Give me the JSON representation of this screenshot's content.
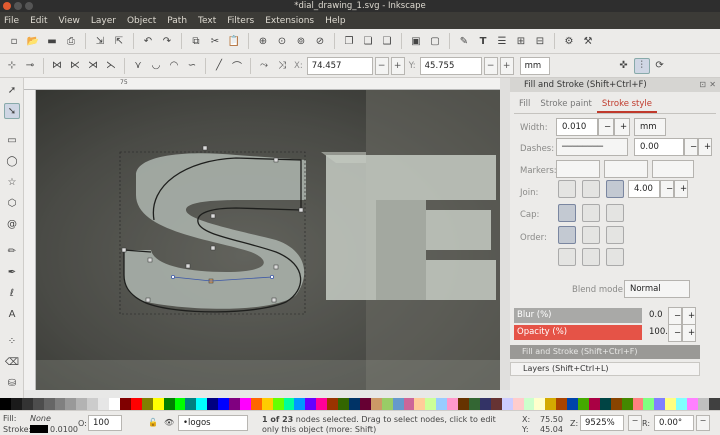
{
  "window": {
    "title": "*dial_drawing_1.svg - Inkscape"
  },
  "menu": [
    "File",
    "Edit",
    "View",
    "Layer",
    "Object",
    "Path",
    "Text",
    "Filters",
    "Extensions",
    "Help"
  ],
  "controls": {
    "x_label": "X:",
    "x_value": "74.457",
    "y_label": "Y:",
    "y_value": "45.755",
    "unit": "mm"
  },
  "ruler": {
    "h_mark": "75"
  },
  "panel": {
    "title": "Fill and Stroke (Shift+Ctrl+F)",
    "tabs": [
      "Fill",
      "Stroke paint",
      "Stroke style"
    ],
    "width_label": "Width:",
    "width_value": "0.010",
    "width_unit": "mm",
    "dashes_label": "Dashes:",
    "dashes_value": "0.00",
    "markers_label": "Markers:",
    "join_label": "Join:",
    "join_value": "4.00",
    "cap_label": "Cap:",
    "order_label": "Order:",
    "blend_label": "Blend mode:",
    "blend_value": "Normal",
    "blur_label": "Blur (%)",
    "blur_value": "0.0",
    "opacity_label": "Opacity (%)",
    "opacity_value": "100.0",
    "collapsed1": "Fill and Stroke (Shift+Ctrl+F)",
    "collapsed2": "Layers (Shift+Ctrl+L)"
  },
  "status": {
    "fill_label": "Fill:",
    "fill_value": "None",
    "stroke_label": "Stroke:",
    "stroke_width": "0.0100",
    "opacity_label": "O:",
    "opacity_value": "100",
    "layer": "•logos",
    "message_count": "1 of 23",
    "message": "nodes selected. Drag to select nodes, click to edit only this object (more: Shift)",
    "cx_label": "X:",
    "cx": "75.50",
    "cy_label": "Y:",
    "cy": "45.04",
    "zoom_label": "Z:",
    "zoom": "9525%",
    "rot_label": "R:",
    "rot": "0.00°"
  },
  "colors": {
    "accent": "#c0392b",
    "opacity_bar": "#e55347"
  },
  "palette": [
    "#000000",
    "#1a1a1a",
    "#333333",
    "#4d4d4d",
    "#666666",
    "#808080",
    "#999999",
    "#b3b3b3",
    "#cccccc",
    "#e6e6e6",
    "#ffffff",
    "#800000",
    "#ff0000",
    "#808000",
    "#ffff00",
    "#008000",
    "#00ff00",
    "#008080",
    "#00ffff",
    "#000080",
    "#0000ff",
    "#800080",
    "#ff00ff",
    "#ff6600",
    "#ffcc00",
    "#66ff00",
    "#00ff99",
    "#0099ff",
    "#6600ff",
    "#ff0099",
    "#993300",
    "#336600",
    "#003366",
    "#660033",
    "#cc9966",
    "#99cc66",
    "#6699cc",
    "#cc6699",
    "#ffcc99",
    "#ccff99",
    "#99ccff",
    "#ff99cc",
    "#663300",
    "#336633",
    "#333366",
    "#663333",
    "#ccccff",
    "#ffcccc",
    "#ccffcc",
    "#ffffcc",
    "#d4aa00",
    "#aa4400",
    "#0044aa",
    "#44aa00",
    "#aa0044",
    "#004444",
    "#884400",
    "#448800",
    "#ff8080",
    "#80ff80",
    "#8080ff",
    "#ffff80",
    "#80ffff",
    "#ff80ff",
    "#c0c0c0",
    "#404040"
  ]
}
